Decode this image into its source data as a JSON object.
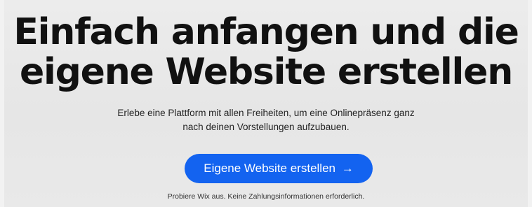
{
  "hero": {
    "headline_line1": "Einfach anfangen und die",
    "headline_line2": "eigene Website erstellen",
    "subtext_line1": "Erlebe eine Plattform mit allen Freiheiten, um eine Onlinepräsenz ganz",
    "subtext_line2": "nach deinen Vorstellungen aufzubauen.",
    "cta_label": "Eigene Website erstellen",
    "cta_arrow": "→",
    "footnote": "Probiere Wix aus. Keine Zahlungsinformationen erforderlich."
  },
  "colors": {
    "accent": "#1363f0",
    "headline": "#111111",
    "background": "#e8e8e8"
  },
  "icons": {
    "cta_icon": "arrow-right-icon"
  }
}
